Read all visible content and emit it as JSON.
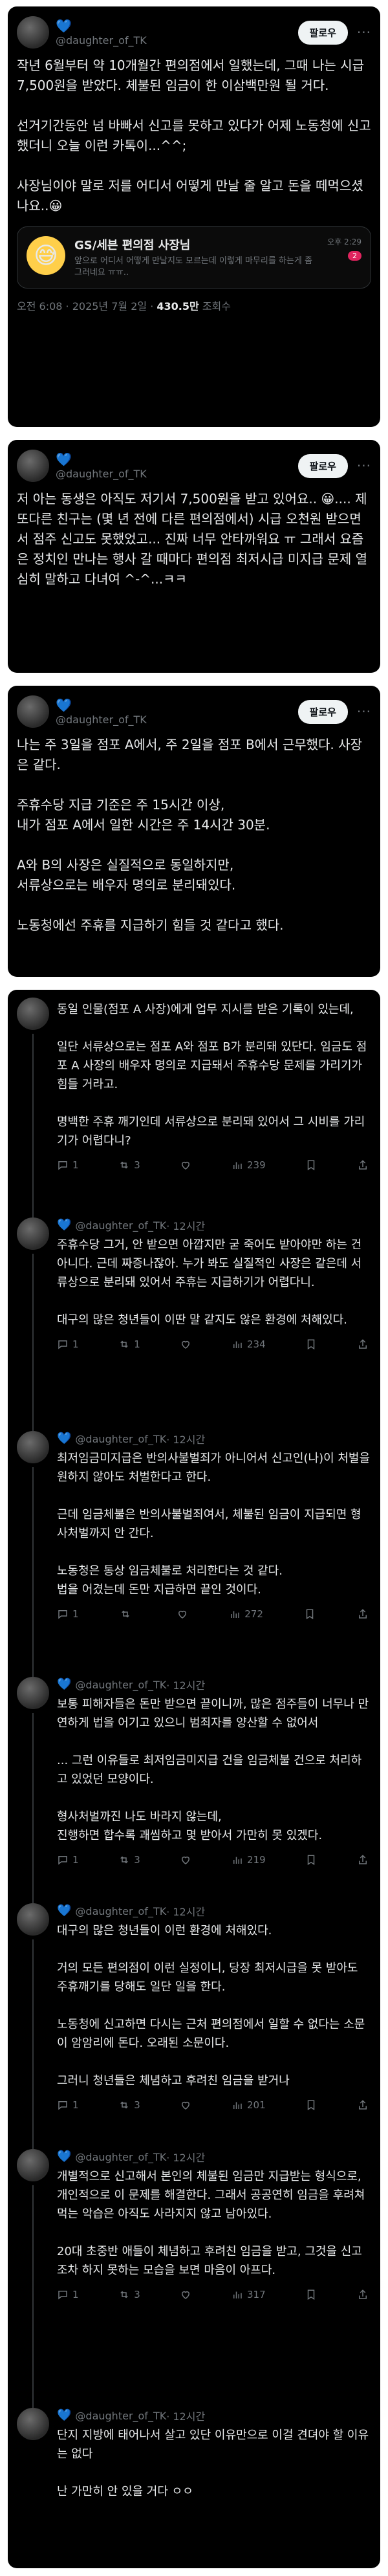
{
  "author": {
    "heart": "💙",
    "handle": "@daughter_of_TK",
    "follow_label": "팔로우",
    "more": "···"
  },
  "post1": {
    "text": "작년 6월부터 약 10개월간 편의점에서 일했는데, 그때 나는 시급 7,500원을 받았다. 체불된 임금이 한 이삼백만원 될 거다.\n\n선거기간동안 넘 바빠서 신고를 못하고 있다가 어제 노동청에 신고했더니 오늘 이런 카톡이...^^;\n\n사장님이야 말로 저를 어디서 어떻게 만날 줄 알고 돈을 떼먹으셨나요..😀",
    "quote": {
      "icon": "😅",
      "title": "GS/세븐 편의점 사장님",
      "message": "앞으로 어디서 어떻게 만날지도 모르는데 이렇게 마무리를 하는게 좀 그러네요 ㅠㅠ..",
      "time": "오후 2:29",
      "badge": "2"
    },
    "meta_time": "오전 6:08 · 2025년 7월 2일 · ",
    "views": "430.5만",
    "views_label": " 조회수"
  },
  "post2": {
    "text": "저 아는 동생은 아직도 저기서 7,500원을 받고 있어요.. 😀.... 제 또다른 친구는 (몇 년 전에 다른 편의점에서) 시급 오천원 받으면서 점주 신고도 못했었고... 진짜 너무 안타까워요 ㅠ 그래서 요즘은 정치인 만나는 행사 갈 때마다 편의점 최저시급 미지급 문제 열심히 말하고 다녀여 ^-^...ㅋㅋ"
  },
  "post3": {
    "text": "나는 주 3일을 점포 A에서, 주 2일을 점포 B에서 근무했다. 사장은 같다.\n\n주휴수당 지급 기준은 주 15시간 이상,\n내가 점포 A에서 일한 시간은 주 14시간 30분.\n\nA와 B의 사장은 실질적으로 동일하지만,\n서류상으로는 배우자 명의로 분리돼있다.\n\n노동청에선 주휴를 지급하기 힘들 것 같다고 했다."
  },
  "replies": [
    {
      "time": "",
      "text": "동일 인물(점포 A 사장)에게 업무 지시를 받은 기록이 있는데,\n\n일단 서류상으로는 점포 A와 점포 B가 분리돼 있단다. 임금도 점포 A 사장의 배우자 명의로 지급돼서 주휴수당 문제를 가리기가 힘들 거라고.\n\n명백한 주휴 깨기인데 서류상으로 분리돼 있어서 그 시비를 가리기가 어렵다니?",
      "replies": "1",
      "retweets": "3",
      "likes": "239"
    },
    {
      "time": " · 12시간",
      "text": "주휴수당 그거, 안 받으면 아깝지만 굳 죽어도 받아야만 하는 건 아니다. 근데 짜증나잖아. 누가 봐도 실질적인 사장은 같은데 서류상으로 분리돼 있어서 주휴는 지급하기가 어렵다니.\n\n대구의 많은 청년들이 이딴 말 같지도 않은 환경에 처해있다.",
      "replies": "1",
      "retweets": "1",
      "likes": "234"
    },
    {
      "time": " · 12시간",
      "text": "최저임금미지급은 반의사불벌죄가 아니어서 신고인(나)이 처벌을 원하지 않아도 처벌한다고 한다.\n\n근데 임금체불은 반의사불벌죄여서, 체불된 임금이 지급되면 형사처벌까지 안 간다.\n\n노동청은 통상 임금체불로 처리한다는 것 같다.\n법을 어겼는데 돈만 지급하면 끝인 것이다.",
      "replies": "1",
      "retweets": "",
      "likes": "272"
    },
    {
      "time": " · 12시간",
      "text": "보통 피해자들은 돈만 받으면 끝이니까, 많은 점주들이 너무나 만연하게 법을 어기고 있으니 범죄자를 양산할 수 없어서\n\n... 그런 이유들로 최저임금미지급 건을 임금체불 건으로 처리하고 있었던 모양이다.\n\n형사처벌까진 나도 바라지 않는데,\n진행하면 합수록 괘씸하고 몇 받아서 가만히 못 있겠다.",
      "replies": "1",
      "retweets": "3",
      "likes": "219"
    },
    {
      "time": " · 12시간",
      "text": "대구의 많은 청년들이 이런 환경에 처해있다.\n\n거의 모든 편의점이 이런 실정이니, 당장 최저시급을 못 받아도 주휴깨기를 당해도 일단 일을 한다.\n\n노동청에 신고하면 다시는 근처 편의점에서 일할 수 없다는 소문이 암암리에 돈다. 오래된 소문이다.\n\n그러니 청년들은 체념하고 후려친 임금을 받거나",
      "replies": "1",
      "retweets": "3",
      "likes": "201"
    },
    {
      "time": " · 12시간",
      "text": "개별적으로 신고해서 본인의 체불된 임금만 지급받는 형식으로, 개인적으로 이 문제를 해결한다. 그래서 공공연히 임금을 후려쳐먹는 악습은 아직도 사라지지 않고 남아있다.\n\n20대 초중반 애들이 체념하고 후려친 임금을 받고, 그것을 신고조차 하지 못하는 모습을 보면 마음이 아프다.",
      "replies": "1",
      "retweets": "3",
      "likes": "317"
    },
    {
      "time": " · 12시간",
      "text": "단지 지방에 태어나서 살고 있단 이유만으로 이걸 견뎌야 할 이유는 없다\n\n난 가만히 안 있을 거다 ㅇㅇ",
      "replies": "",
      "retweets": "",
      "likes": ""
    }
  ]
}
